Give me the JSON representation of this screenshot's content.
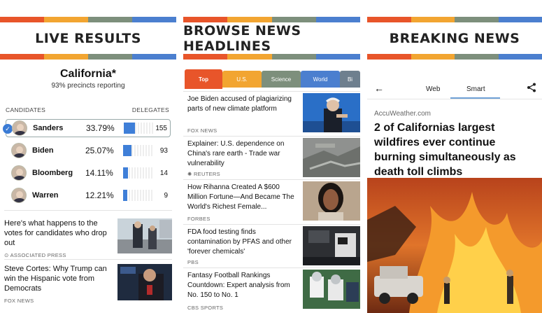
{
  "stripe_colors": [
    "#e8552a",
    "#f2a531",
    "#7d8f7c",
    "#4b7fcf"
  ],
  "live": {
    "banner": "LIVE RESULTS",
    "state": "California*",
    "precincts": "93% precincts reporting",
    "col_candidates": "CANDIDATES",
    "col_delegates": "DELEGATES",
    "bar_color": "#3f7fd8",
    "candidates": [
      {
        "name": "Sanders",
        "pct": "33.79%",
        "delegates": "155",
        "share": 0.3379
      },
      {
        "name": "Biden",
        "pct": "25.07%",
        "delegates": "93",
        "share": 0.2507
      },
      {
        "name": "Bloomberg",
        "pct": "14.11%",
        "delegates": "14",
        "share": 0.1411
      },
      {
        "name": "Warren",
        "pct": "12.21%",
        "delegates": "9",
        "share": 0.1221
      }
    ],
    "stories": [
      {
        "headline": "Here's what happens to the votes for candidates who drop out",
        "source": "ASSOCIATED PRESS",
        "icon": "ap-icon"
      },
      {
        "headline": "Steve Cortes: Why Trump can win the Hispanic vote from Democrats",
        "source": "FOX NEWS"
      }
    ]
  },
  "browse": {
    "banner": "BROWSE NEWS HEADLINES",
    "tabs": [
      {
        "label": "Top",
        "color": "#e8552a"
      },
      {
        "label": "U.S.",
        "color": "#f2a531"
      },
      {
        "label": "Science",
        "color": "#7d8f7c"
      },
      {
        "label": "World",
        "color": "#4b7fcf"
      },
      {
        "label": "Bi",
        "color": "#6e7f8e"
      }
    ],
    "items": [
      {
        "headline": "Joe Biden accused of plagiarizing parts of new climate platform",
        "source": "FOX NEWS"
      },
      {
        "headline": "Explainer: U.S. dependence on China's rare earth - Trade war vulnerability",
        "source": "REUTERS"
      },
      {
        "headline": "How Rihanna Created A $600 Million Fortune—And Became The World's Richest Female...",
        "source": "FORBES"
      },
      {
        "headline": "FDA food testing finds contamination by PFAS and other 'forever chemicals'",
        "source": "PBS"
      },
      {
        "headline": "Fantasy Football Rankings Countdown: Expert analysis from No. 150 to No. 1",
        "source": "CBS SPORTS"
      }
    ]
  },
  "breaking": {
    "banner": "BREAKING NEWS",
    "tab_web": "Web",
    "tab_smart": "Smart",
    "site": "AccuWeather.com",
    "headline": "2 of Californias largest wildfires ever continue burning simultaneously as death toll climbs"
  }
}
